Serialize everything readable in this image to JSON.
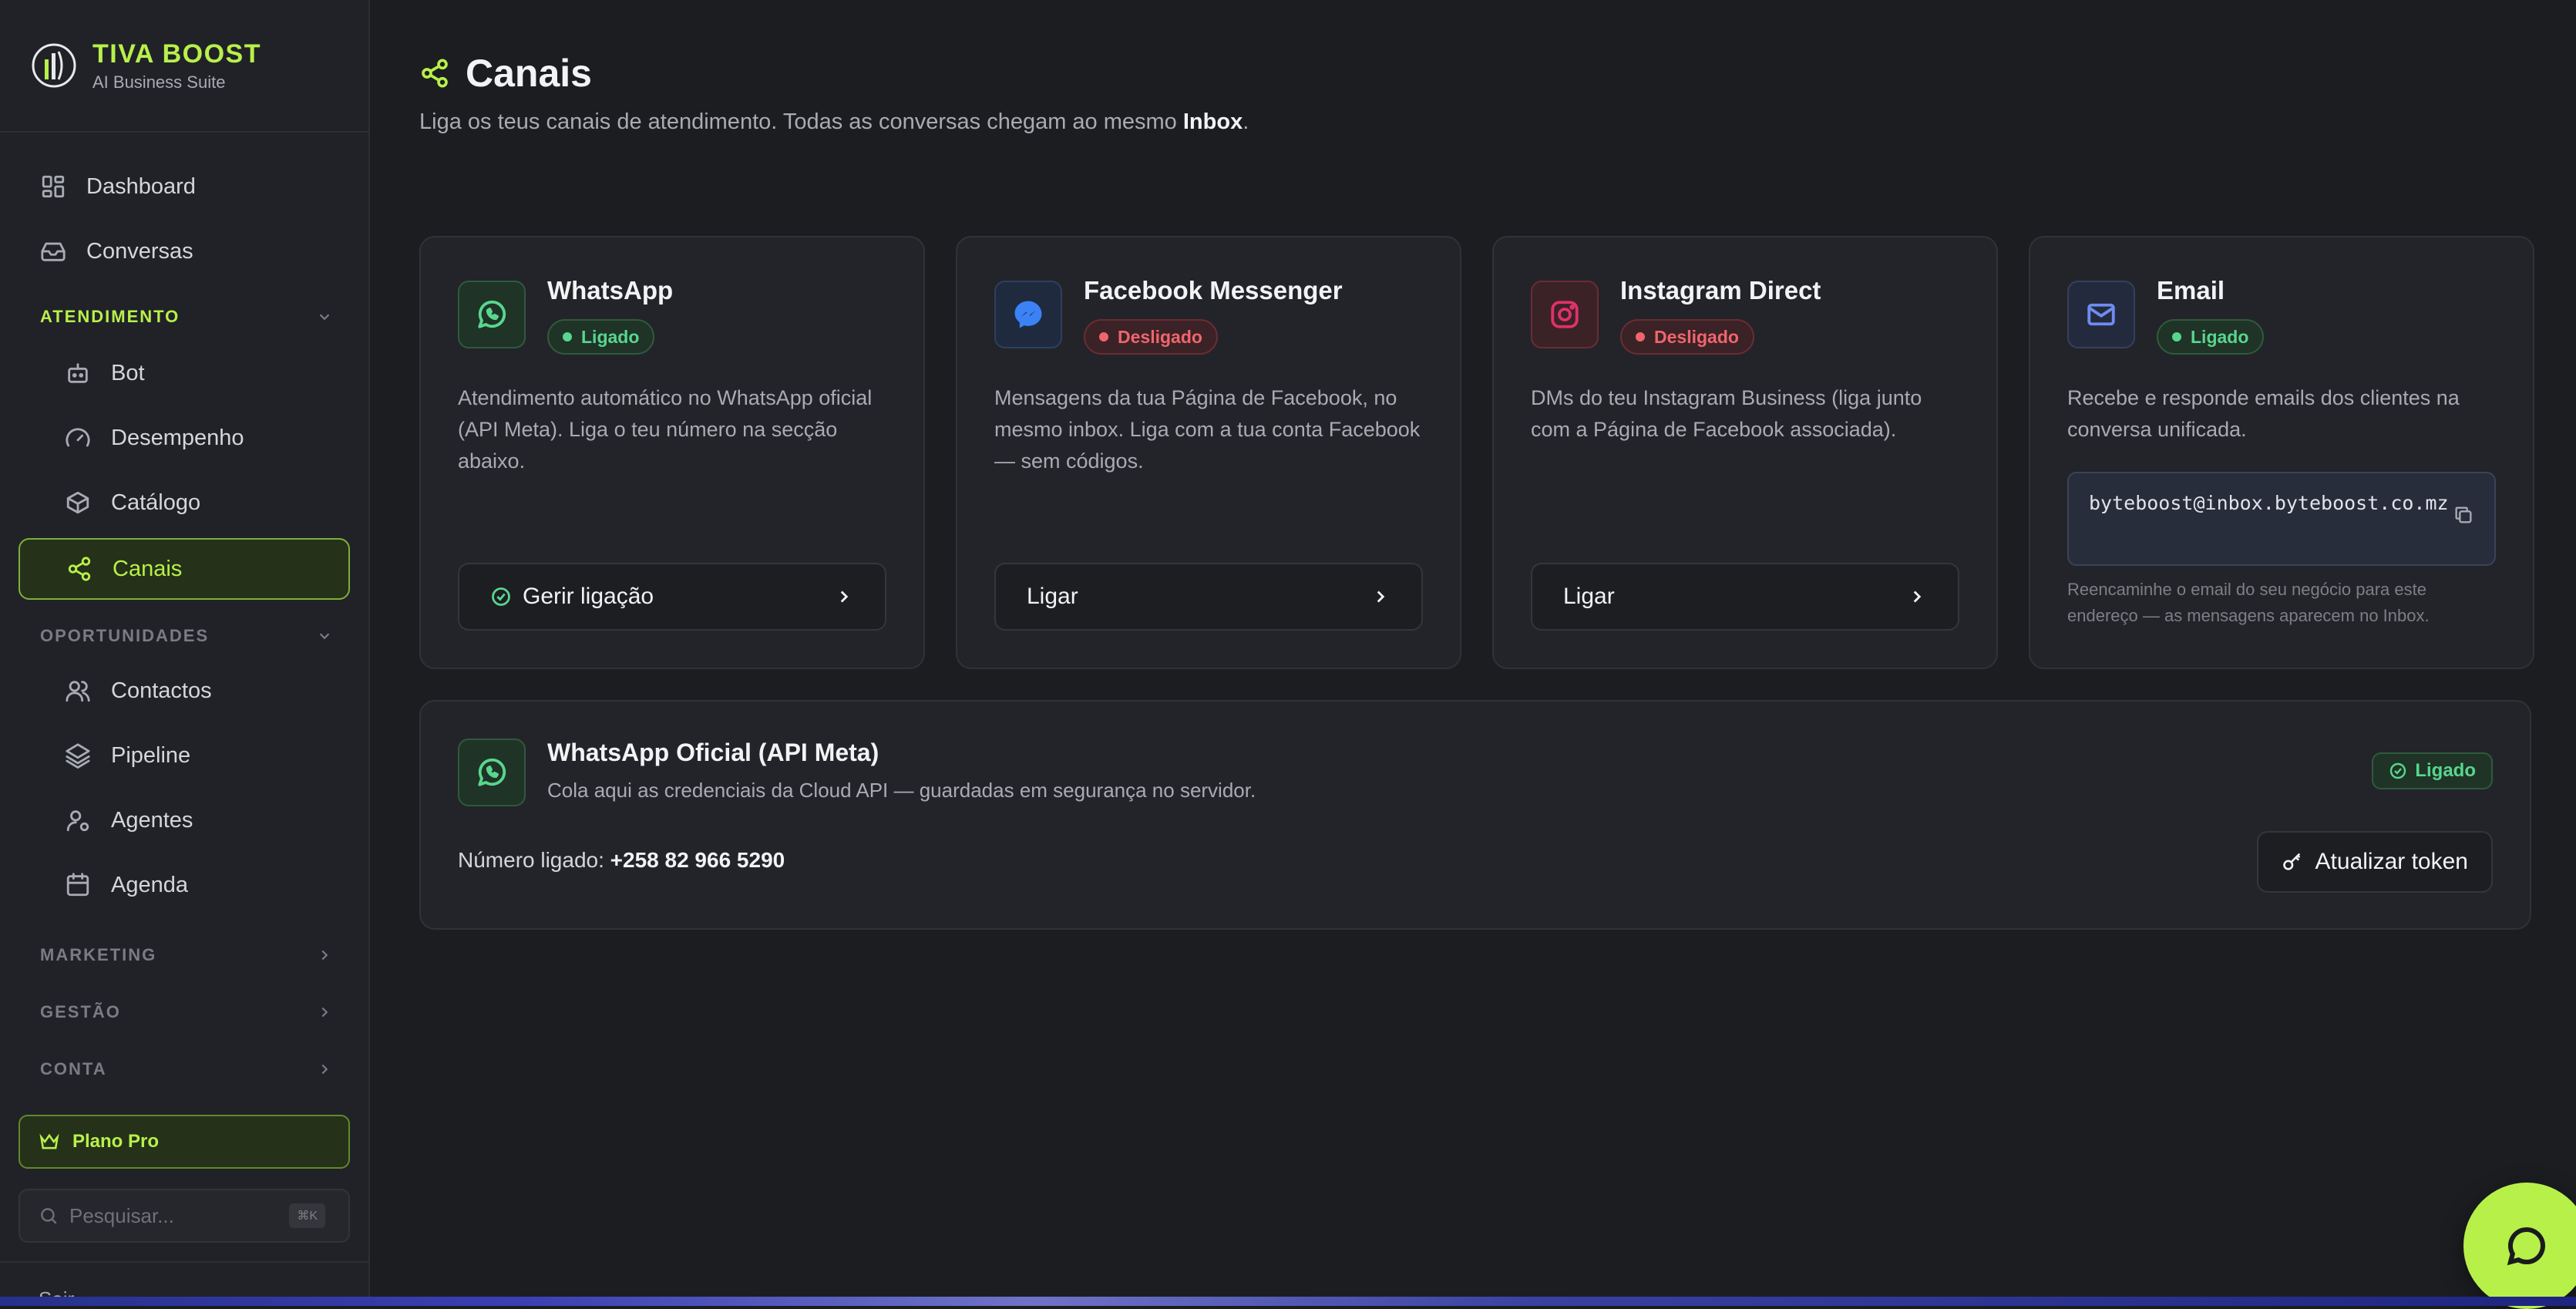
{
  "brand": {
    "name": "TIVA BOOST",
    "tagline": "AI Business Suite"
  },
  "sidebar": {
    "dashboard": "Dashboard",
    "conversas": "Conversas",
    "sections": {
      "atendimento": "ATENDIMENTO",
      "oportunidades": "OPORTUNIDADES",
      "marketing": "MARKETING",
      "gestao": "GESTÃO",
      "conta": "CONTA"
    },
    "atendimento_items": [
      "Bot",
      "Desempenho",
      "Catálogo",
      "Canais"
    ],
    "oportunidades_items": [
      "Contactos",
      "Pipeline",
      "Agentes",
      "Agenda"
    ],
    "plan": "Plano Pro",
    "search_placeholder": "Pesquisar...",
    "search_shortcut": "⌘K",
    "cut_item": "Sair"
  },
  "page": {
    "title": "Canais",
    "subtitle_prefix": "Liga os teus canais de atendimento. Todas as conversas chegam ao mesmo ",
    "subtitle_bold": "Inbox",
    "subtitle_suffix": "."
  },
  "channels": [
    {
      "name": "WhatsApp",
      "status": "Ligado",
      "desc": "Atendimento automático no WhatsApp oficial (API Meta). Liga o teu número na secção abaixo.",
      "button": "Gerir ligação"
    },
    {
      "name": "Facebook Messenger",
      "status": "Desligado",
      "desc": "Mensagens da tua Página de Facebook, no mesmo inbox. Liga com a tua conta Facebook — sem códigos.",
      "button": "Ligar"
    },
    {
      "name": "Instagram Direct",
      "status": "Desligado",
      "desc": "DMs do teu Instagram Business (liga junto com a Página de Facebook associada).",
      "button": "Ligar"
    },
    {
      "name": "Email",
      "status": "Ligado",
      "desc": "Recebe e responde emails dos clientes na conversa unificada.",
      "address": "byteboost@inbox.byteboost.co.mz",
      "note": "Reencaminhe o email do seu negócio para este endereço — as mensagens aparecem no Inbox."
    }
  ],
  "whatsapp_api": {
    "title": "WhatsApp Oficial (API Meta)",
    "subtitle": "Cola aqui as credenciais da Cloud API — guardadas em segurança no servidor.",
    "status": "Ligado",
    "number_label": "Número ligado: ",
    "number": "+258 82 966 5290",
    "token_button": "Atualizar token"
  },
  "colors": {
    "accent": "#b8f04a",
    "connected": "#58d68d",
    "disconnected": "#f0656d",
    "whatsapp": "#25d366",
    "messenger": "#3b82f6",
    "instagram": "#e1306c",
    "email": "#6e8cf0"
  }
}
